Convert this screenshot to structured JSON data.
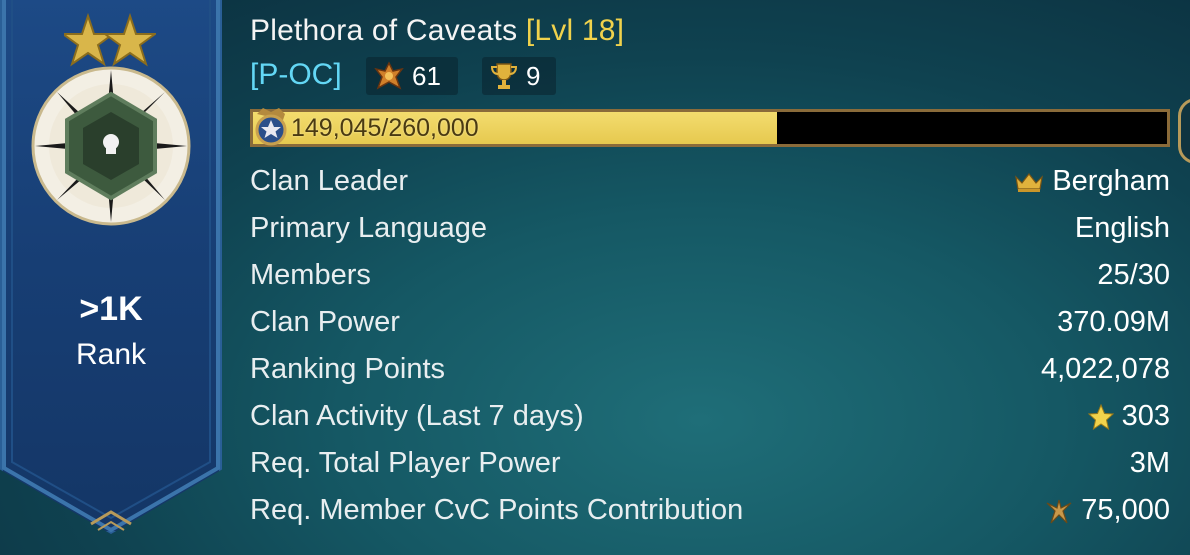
{
  "clan": {
    "name": "Plethora of Caveats",
    "level": "[Lvl 18]",
    "tag": "[P-OC]",
    "cvc_count": "61",
    "trophy_count": "9",
    "xp_text": "149,045/260,000",
    "xp_progress_fraction": 0.573
  },
  "rank": {
    "value": ">1K",
    "label": "Rank",
    "stars": 2
  },
  "details": [
    {
      "label": "Clan Leader",
      "value": "Bergham",
      "icon": "crown-icon"
    },
    {
      "label": "Primary Language",
      "value": "English",
      "icon": ""
    },
    {
      "label": "Members",
      "value": "25/30",
      "icon": ""
    },
    {
      "label": "Clan Power",
      "value": "370.09M",
      "icon": ""
    },
    {
      "label": "Ranking Points",
      "value": "4,022,078",
      "icon": ""
    },
    {
      "label": "Clan Activity (Last 7 days)",
      "value": "303",
      "icon": "star-icon"
    },
    {
      "label": "Req. Total Player Power",
      "value": "3M",
      "icon": ""
    },
    {
      "label": "Req. Member CvC Points Contribution",
      "value": "75,000",
      "icon": "cvc-points-icon"
    }
  ],
  "colors": {
    "banner": "#173e74",
    "level_gold": "#f0d24c",
    "tag_cyan": "#63d7f5",
    "xp_fill": "#e6c94f"
  }
}
